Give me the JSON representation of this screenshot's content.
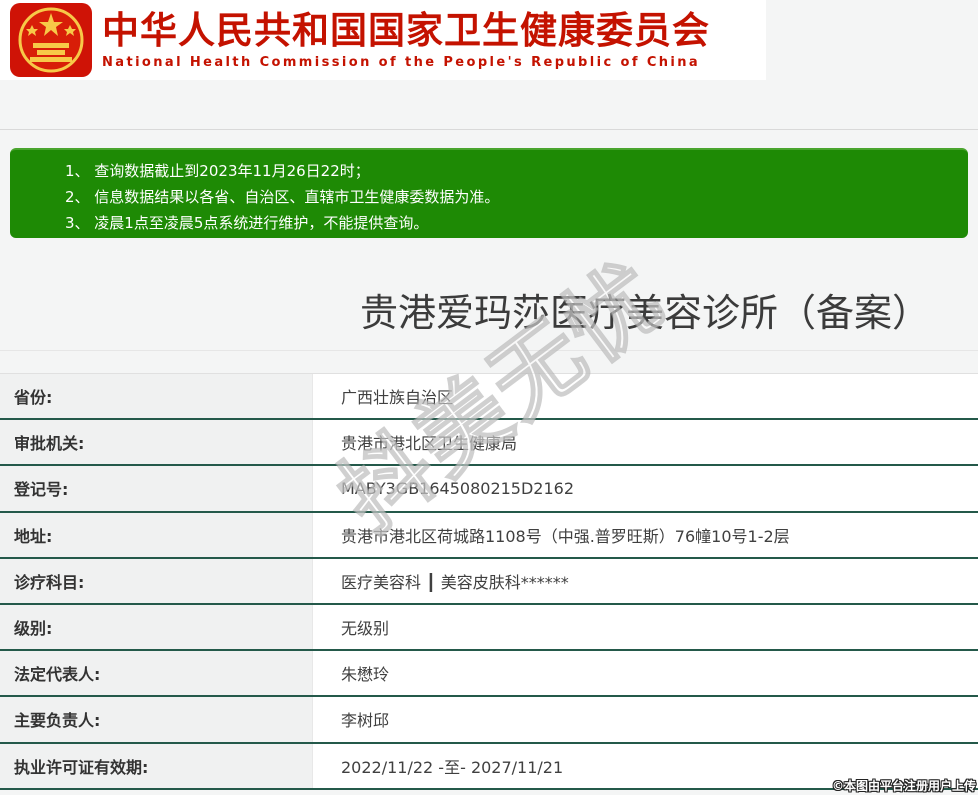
{
  "header": {
    "title_cn": "中华人民共和国国家卫生健康委员会",
    "title_en": "National Health Commission of the People's Republic of China",
    "brand_red": "#c41200"
  },
  "notice": {
    "bg": "#1e8a05",
    "lines": [
      "1、 查询数据截止到2023年11月26日22时；",
      "2、 信息数据结果以各省、自治区、直辖市卫生健康委数据为准。",
      "3、 凌晨1点至凌晨5点系统进行维护，不能提供查询。"
    ]
  },
  "record": {
    "title": "贵港爱玛莎医疗美容诊所（备案）",
    "fields": [
      {
        "label": "省份:",
        "value": "广西壮族自治区"
      },
      {
        "label": "审批机关:",
        "value": "贵港市港北区卫生健康局"
      },
      {
        "label": "登记号:",
        "value": "MABY3GB1645080215D2162"
      },
      {
        "label": "地址:",
        "value": "贵港市港北区荷城路1108号（中强.普罗旺斯）76幢10号1-2层"
      },
      {
        "label": "诊疗科目:",
        "value": "医疗美容科 ┃ 美容皮肤科******"
      },
      {
        "label": "级别:",
        "value": "无级别"
      },
      {
        "label": "法定代表人:",
        "value": "朱懋玲"
      },
      {
        "label": "主要负责人:",
        "value": "李树邱"
      },
      {
        "label": "执业许可证有效期:",
        "value": "2022/11/22 -至- 2027/11/21"
      }
    ]
  },
  "watermark": "抖美无忧",
  "footer": {
    "copyright": "©本图由平台注册用户上传"
  }
}
